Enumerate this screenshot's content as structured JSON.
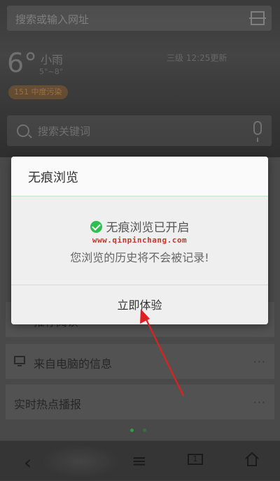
{
  "browser": {
    "url_placeholder": "搜索或输入网址"
  },
  "weather": {
    "temperature": "6°",
    "condition": "小雨",
    "range": "5°~8°",
    "info": "三级  12:25更新",
    "air_quality": "151 中度污染"
  },
  "search": {
    "placeholder": "搜索关键词"
  },
  "cards": [
    {
      "label": "推荐阅读"
    },
    {
      "label": "来自电脑的信息"
    },
    {
      "label": "实时热点播报"
    }
  ],
  "dialog": {
    "title": "无痕浏览",
    "status": "无痕浏览已开启",
    "watermark": "www.qinpinchang.com",
    "description": "您浏览的历史将不会被记录!",
    "confirm_label": "立即体验"
  },
  "bottom_nav": {
    "back": "‹",
    "menu": "≡",
    "tabs_count": "1"
  },
  "colors": {
    "accent_green": "#2ebf4f",
    "annotation_red": "#e02020",
    "watermark_red": "#c0392b"
  }
}
